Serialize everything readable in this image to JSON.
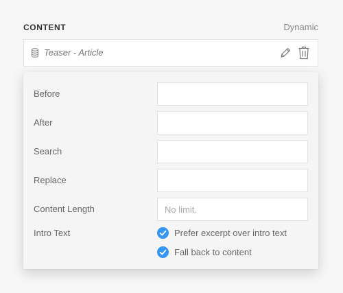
{
  "header": {
    "title": "CONTENT",
    "type": "Dynamic"
  },
  "source": {
    "label": "Teaser - Article",
    "icons": {
      "source": "database-icon",
      "edit": "pencil-icon",
      "delete": "trash-icon"
    }
  },
  "panel": {
    "fields": [
      {
        "label": "Before",
        "value": "",
        "placeholder": ""
      },
      {
        "label": "After",
        "value": "",
        "placeholder": ""
      },
      {
        "label": "Search",
        "value": "",
        "placeholder": ""
      },
      {
        "label": "Replace",
        "value": "",
        "placeholder": ""
      },
      {
        "label": "Content Length",
        "value": "",
        "placeholder": "No limit."
      }
    ],
    "intro_text": {
      "label": "Intro Text",
      "options": [
        {
          "label": "Prefer excerpt over intro text",
          "checked": true
        },
        {
          "label": "Fall back to content",
          "checked": true
        }
      ]
    }
  },
  "colors": {
    "accent": "#3696f3",
    "panel_bg": "#f5f5f5",
    "page_bg": "#f7f7f7",
    "border": "#e3e3e3"
  }
}
